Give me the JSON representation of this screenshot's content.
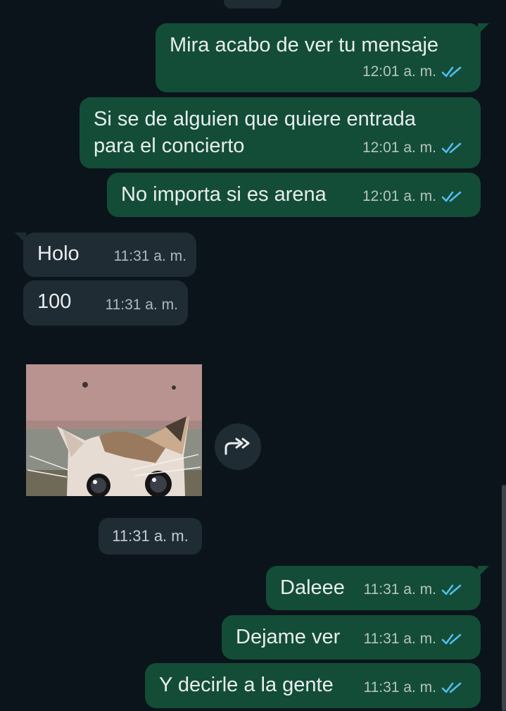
{
  "chat": {
    "messages": [
      {
        "text": "Mira acabo de ver tu mensaje",
        "time": "12:01 a. m.",
        "status": "read-double-check"
      },
      {
        "text": "Si se de alguien que quiere entrada\npara el concierto",
        "time": "12:01 a. m.",
        "status": "read-double-check"
      },
      {
        "text": "No importa si es arena",
        "time": "12:01 a. m.",
        "status": "read-double-check"
      },
      {
        "text": "Holo",
        "time": "11:31 a. m."
      },
      {
        "text": "100",
        "time": "11:31 a. m."
      },
      {
        "text": "Daleee",
        "time": "11:31 a. m.",
        "status": "read-double-check"
      },
      {
        "text": "Dejame ver",
        "time": "11:31 a. m.",
        "status": "read-double-check"
      },
      {
        "text": "Y decirle a la gente",
        "time": "11:31 a. m.",
        "status": "read-double-check"
      }
    ],
    "media": {
      "kind": "photo",
      "subject": "kitten",
      "time": "11:31 a. m."
    },
    "forward_icon": "forward-icon",
    "colors": {
      "background": "#0b141a",
      "outgoing_bubble": "#134d37",
      "incoming_bubble": "#1f2c34",
      "read_tick": "#53bdeb",
      "text": "#e9edef"
    }
  }
}
